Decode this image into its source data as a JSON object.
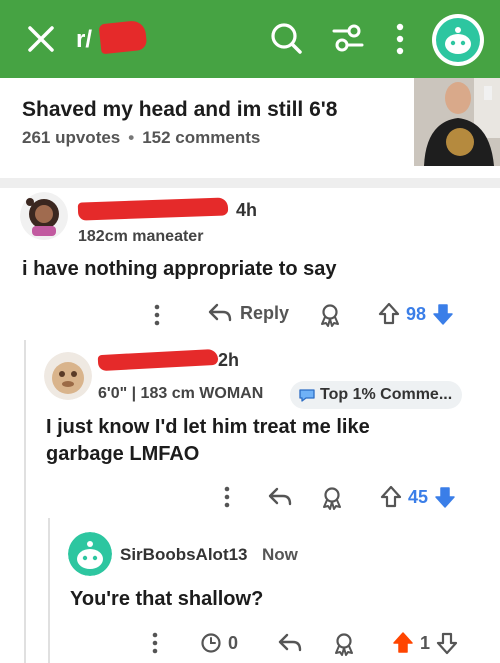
{
  "topbar": {
    "subreddit_prefix": "r/",
    "background": "#46a343",
    "icons": [
      "close-icon",
      "search-icon",
      "filter-icon",
      "more-vertical-icon",
      "user-avatar"
    ]
  },
  "post": {
    "title": "Shaved my head and im still 6'8",
    "upvotes": "261 upvotes",
    "comments": "152 comments",
    "separator": "•"
  },
  "comments": [
    {
      "age": "4h",
      "flair": "182cm maneater",
      "body": "i have nothing appropriate to say",
      "reply_label": "Reply",
      "score": "98",
      "score_color": "#3a7ee8"
    },
    {
      "age": "2h",
      "flair": "6'0\" | 183 cm WOMAN",
      "badge": "Top 1% Comme...",
      "body_line1": "I just know I'd let him treat me like",
      "body_line2": "garbage LMFAO",
      "score": "45",
      "score_color": "#3a7ee8"
    },
    {
      "username": "SirBoobsAlot13",
      "age": "Now",
      "body": "You're that shallow?",
      "awards": "0",
      "score": "1",
      "score_color": "#ff4500"
    }
  ]
}
